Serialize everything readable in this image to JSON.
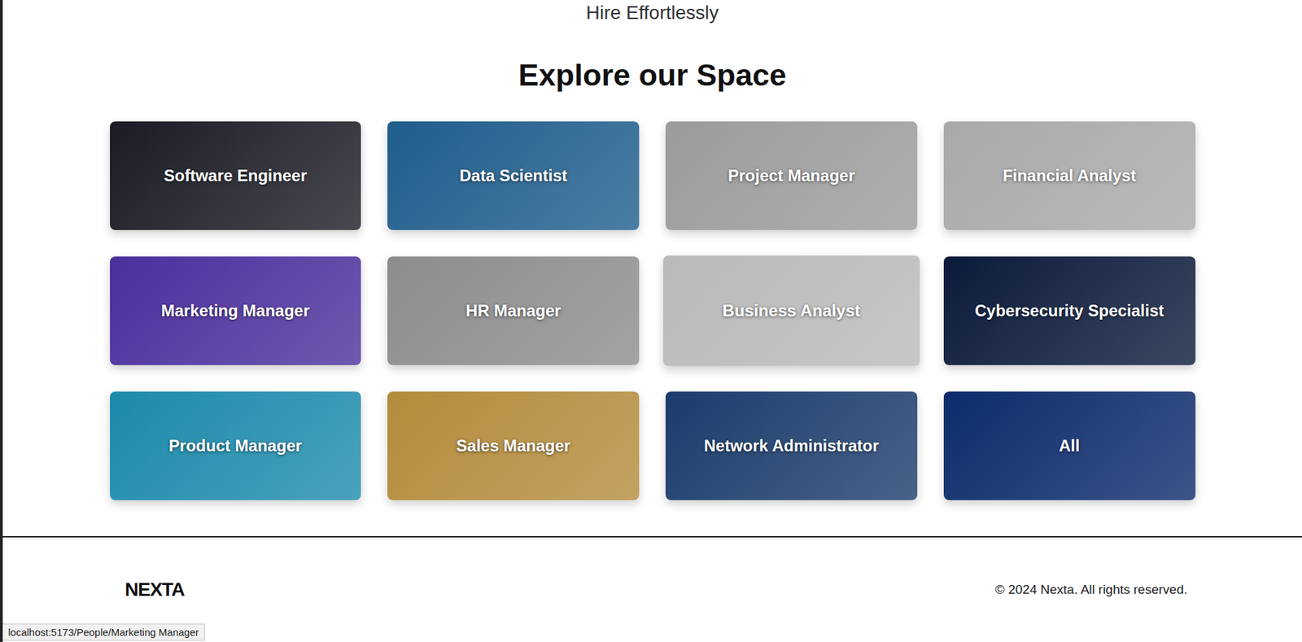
{
  "page": {
    "tagline": "Hire Effortlessly",
    "heading": "Explore our Space"
  },
  "cards": [
    {
      "label": "Software Engineer",
      "color": "#1b1b24",
      "highlighted": false
    },
    {
      "label": "Data Scientist",
      "color": "#1f5d8c",
      "highlighted": false
    },
    {
      "label": "Project Manager",
      "color": "#9b9b9b",
      "highlighted": false
    },
    {
      "label": "Financial Analyst",
      "color": "#a9a9a9",
      "highlighted": false
    },
    {
      "label": "Marketing Manager",
      "color": "#4b2f9c",
      "highlighted": false
    },
    {
      "label": "HR Manager",
      "color": "#8c8c8c",
      "highlighted": false
    },
    {
      "label": "Business Analyst",
      "color": "#b9b9b9",
      "highlighted": true
    },
    {
      "label": "Cybersecurity Specialist",
      "color": "#0b1a3a",
      "highlighted": false
    },
    {
      "label": "Product Manager",
      "color": "#1c8aab",
      "highlighted": false
    },
    {
      "label": "Sales Manager",
      "color": "#b38b3b",
      "highlighted": false
    },
    {
      "label": "Network Administrator",
      "color": "#1b3c6c",
      "highlighted": false
    },
    {
      "label": "All",
      "color": "#0b2b6b",
      "highlighted": false
    }
  ],
  "footer": {
    "logo": "NEXTA",
    "copyright": "© 2024 Nexta. All rights reserved."
  },
  "status_bar": "localhost:5173/People/Marketing Manager"
}
